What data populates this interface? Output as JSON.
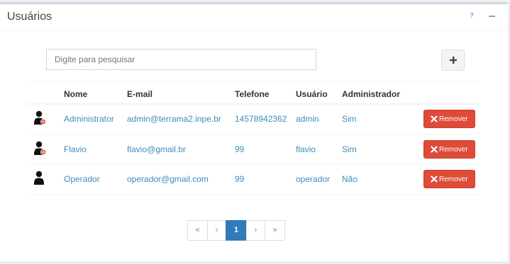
{
  "panel": {
    "title": "Usuários",
    "help_label": "?"
  },
  "search": {
    "placeholder": "Digite para pesquisar",
    "value": ""
  },
  "add_button": {
    "icon": "plus-icon"
  },
  "table": {
    "headers": [
      "Nome",
      "E-mail",
      "Telefone",
      "Usuário",
      "Administrador"
    ],
    "rows": [
      {
        "icon": "user-admin-icon",
        "name": "Administrator",
        "email": "admin@terrama2.inpe.br",
        "phone": "14578942362",
        "username": "admin",
        "admin": "Sim",
        "action": "Remover"
      },
      {
        "icon": "user-admin-icon",
        "name": "Flavio",
        "email": "flavio@gmail.br",
        "phone": "99",
        "username": "flavio",
        "admin": "Sim",
        "action": "Remover"
      },
      {
        "icon": "user-icon",
        "name": "Operador",
        "email": "operador@gmail.com",
        "phone": "99",
        "username": "operador",
        "admin": "Não",
        "action": "Remover"
      }
    ]
  },
  "pagination": {
    "first": "«",
    "prev": "‹",
    "current": "1",
    "next": "›",
    "last": "»"
  },
  "colors": {
    "link": "#3c8dbc",
    "danger": "#dd4b39",
    "primary": "#337ab7"
  }
}
